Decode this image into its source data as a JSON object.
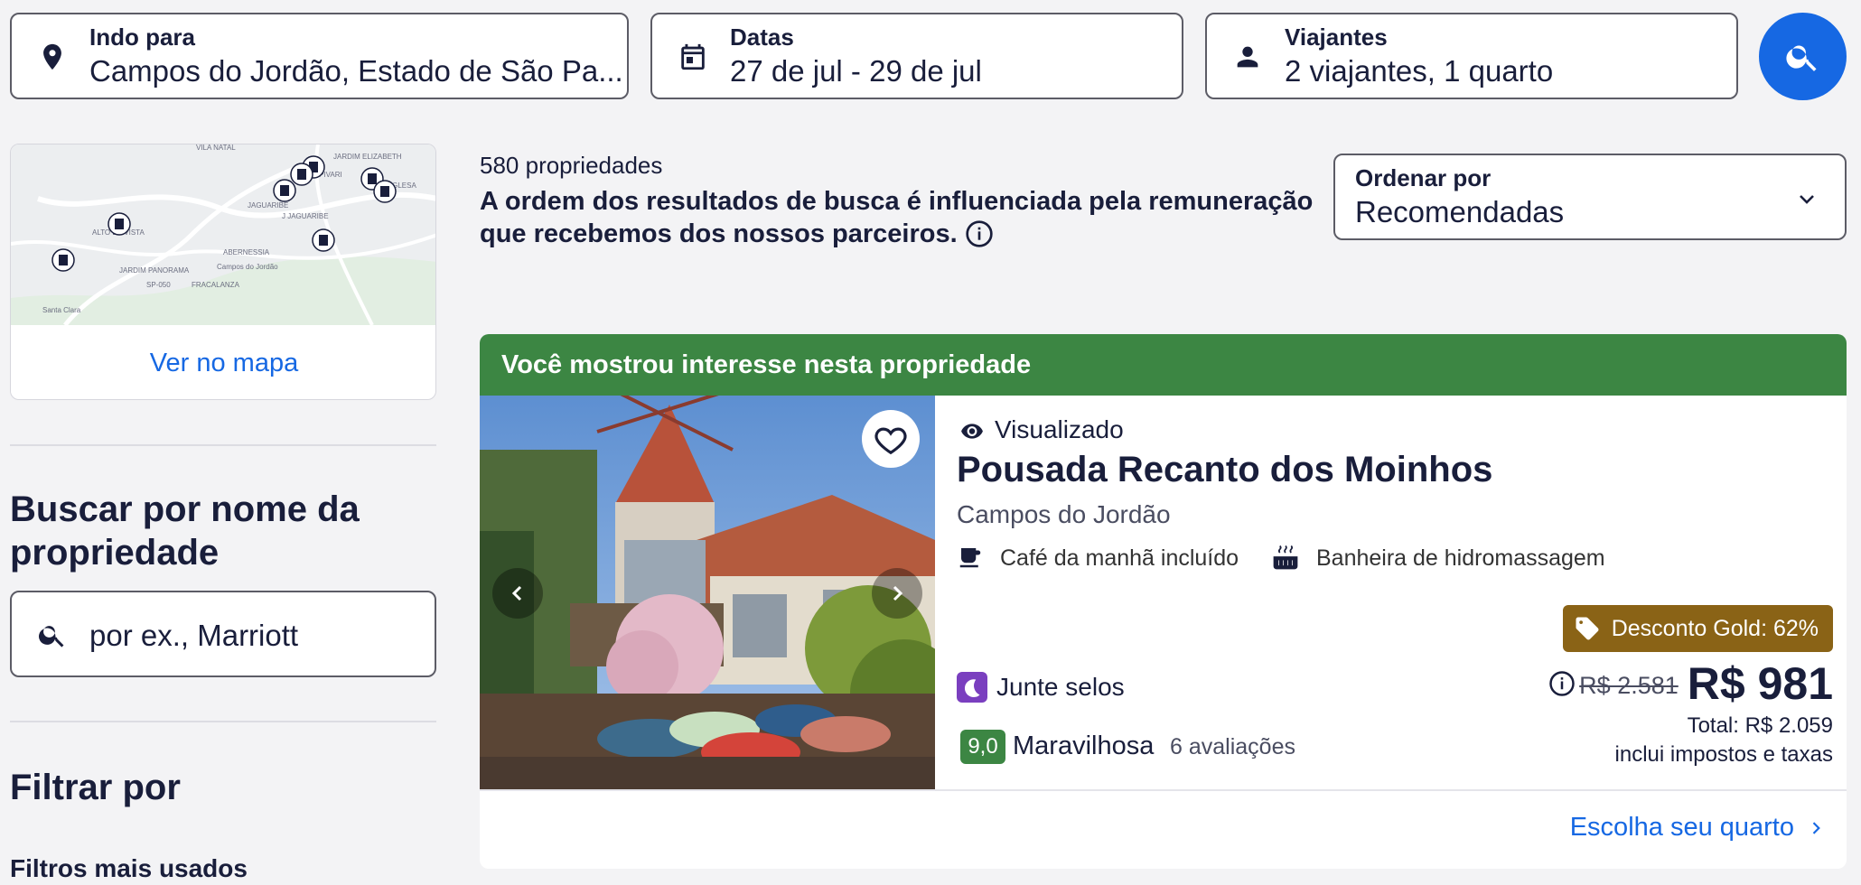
{
  "search": {
    "destination_label": "Indo para",
    "destination_value": "Campos do Jordão, Estado de São Pa...",
    "dates_label": "Datas",
    "dates_value": "27 de jul - 29 de jul",
    "travelers_label": "Viajantes",
    "travelers_value": "2 viajantes, 1 quarto",
    "search_icon": "search-icon"
  },
  "sidebar": {
    "map": {
      "link_label": "Ver no mapa",
      "place_labels": [
        "VILA NATAL",
        "JARDIM ELIZABETH",
        "CAPIVARI",
        "VILA INGLESA",
        "JAGUARIBE",
        "J JAGUARIBE",
        "ALTO DA VISTA",
        "ABERNESSIA",
        "Campos do Jordão",
        "JARDIM PANORAMA",
        "SP-050",
        "FRACALANZA",
        "Santa Clara"
      ]
    },
    "search_name_title": "Buscar por nome da propriedade",
    "search_name_placeholder": "por ex., Marriott",
    "filter_title": "Filtrar por",
    "filter_subtitle": "Filtros mais usados"
  },
  "results": {
    "count": "580 propriedades",
    "disclaimer": "A ordem dos resultados de busca é influenciada pela remuneração que recebemos dos nossos parceiros.",
    "sort_label": "Ordenar por",
    "sort_value": "Recomendadas"
  },
  "card": {
    "banner": "Você mostrou interesse nesta propriedade",
    "viewed_label": "Visualizado",
    "name": "Pousada Recanto dos Moinhos",
    "location": "Campos do Jordão",
    "amenities": [
      "Café da manhã incluído",
      "Banheira de hidromassagem"
    ],
    "stamps_label": "Junte selos",
    "rating_score": "9,0",
    "rating_word": "Maravilhosa",
    "rating_count": "6 avaliações",
    "discount": "Desconto Gold: 62%",
    "old_price": "R$ 2.581",
    "price": "R$ 981",
    "total": "Total: R$ 2.059",
    "taxes_note": "inclui impostos e taxas",
    "cta": "Escolha seu quarto"
  },
  "colors": {
    "accent": "#1668e3",
    "banner_green": "#3c8643",
    "discount_gold": "#8a6316",
    "rating_green": "#3c8643",
    "stamps_purple": "#7a3fbf"
  }
}
